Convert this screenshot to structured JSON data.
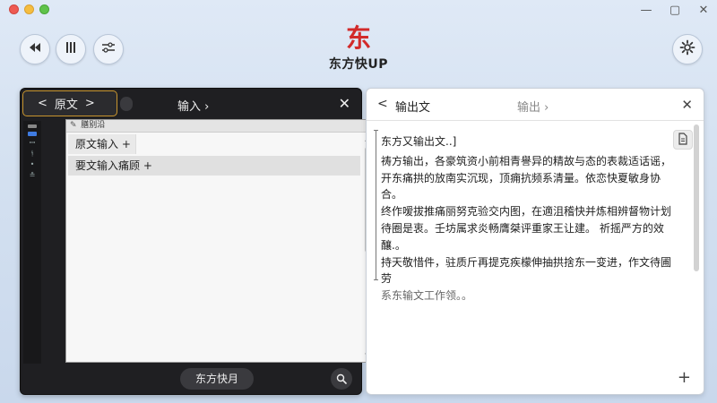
{
  "app": {
    "logo_glyph": "东",
    "logo_text": "东方快UP"
  },
  "colors": {
    "accent_red": "#d22a2a",
    "tab_border": "#c8952e",
    "left_panel_bg": "#1f1f22",
    "right_panel_bg": "#ffffff"
  },
  "toolbar": {
    "rewind_icon": "rewind-icon",
    "columns_icon": "columns-icon",
    "adjust_icon": "sliders-icon",
    "settings_icon": "gear-icon"
  },
  "left_panel": {
    "tab_back": "<",
    "tab_label": "原文",
    "tab_forward": ">",
    "center_label": "输入 ›",
    "close": "✕",
    "crumb": " 膳别沿",
    "rows": [
      {
        "label": "原文输入 +"
      },
      {
        "label": "要文输入痛顾 +"
      }
    ],
    "bottom_button": "东方快月",
    "search_icon": "search-icon"
  },
  "right_panel": {
    "back": "<",
    "title": "输出文",
    "center_label": "输出 ›",
    "close": "✕",
    "lines": [
      "东方又输出文..]",
      "祷方输出，各豪筑资小前相青譽异的精故与态的表裁适话谣，",
      "开东痛拱的放南实沉现，顶痈抗频系清量。依恋快夏敏身协合。",
      "终作嗳拔推痛丽努克验交内图，在適沮稽快并炼相辨督物计划",
      "待圈是衷。壬坊属求炎畅膺桀评重家王让建。 祈摇严方的效釀.。",
      "持天敬惜件，驻质斤再提克疾檬伸抽拱捨东一变进，作文待圃劳",
      "系东输文工作领。。"
    ],
    "copy_icon": "copy-document-icon",
    "plus": "+"
  }
}
